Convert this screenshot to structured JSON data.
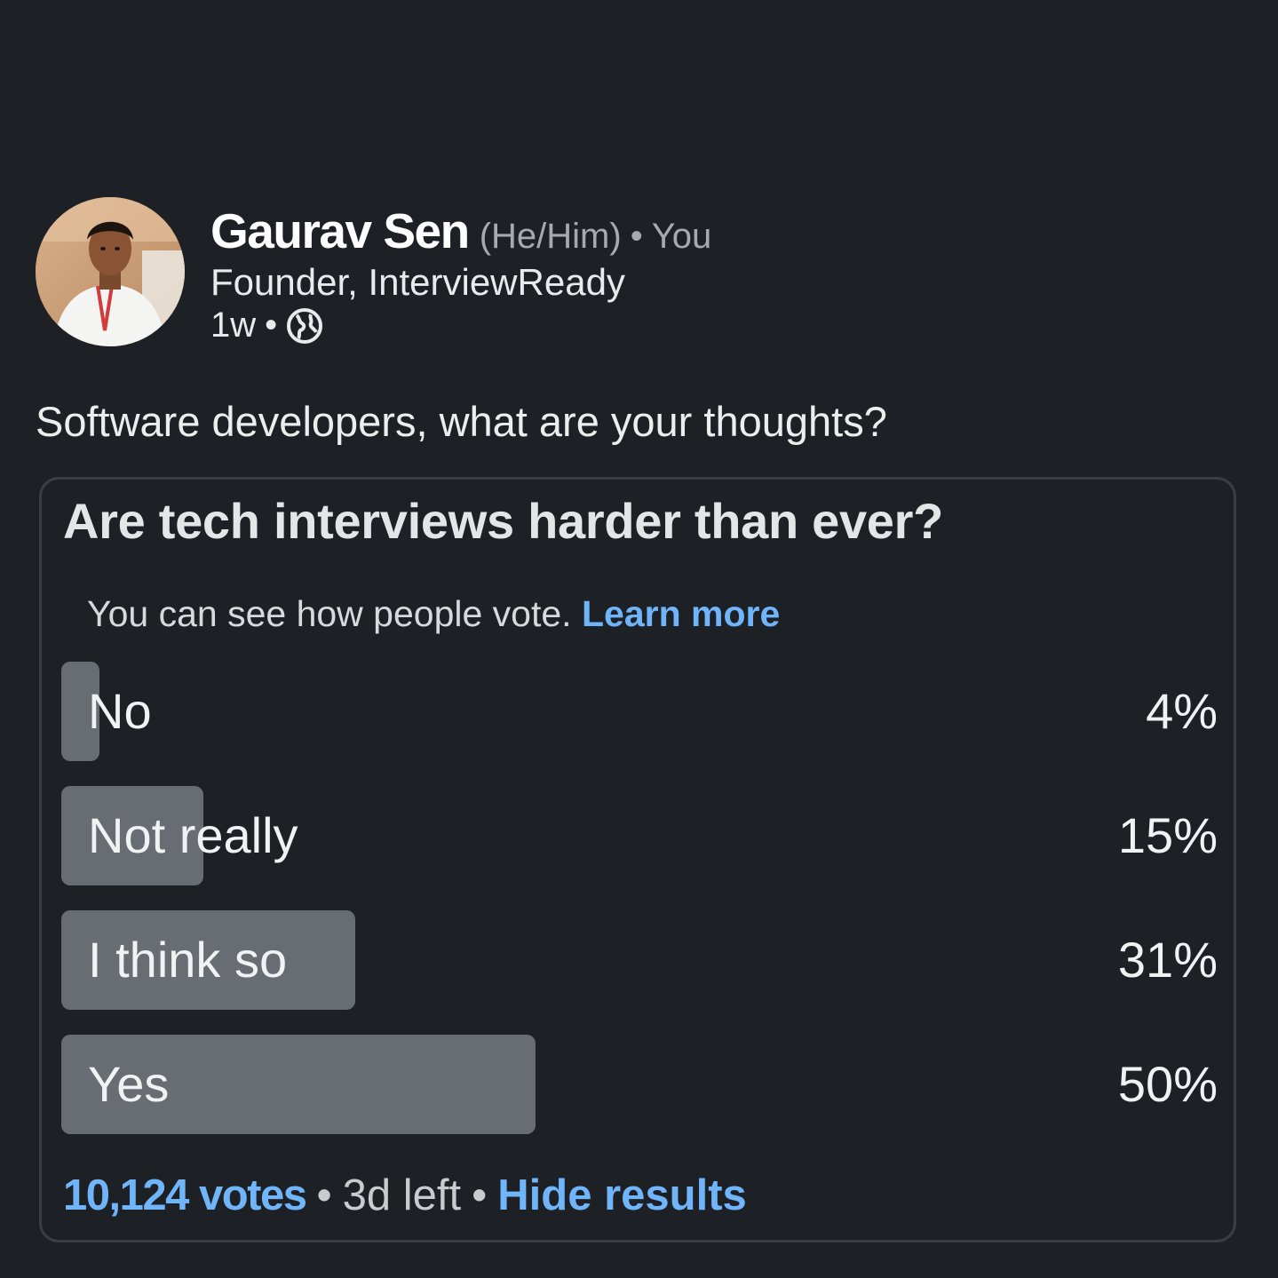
{
  "author": {
    "name": "Gaurav Sen",
    "pronouns": "(He/Him)",
    "separator": "•",
    "relation": "You",
    "headline": "Founder, InterviewReady",
    "age": "1w",
    "visibility_icon": "globe-icon"
  },
  "post": {
    "text": "Software developers, what are your thoughts?"
  },
  "poll": {
    "question": "Are tech interviews harder than ever?",
    "visibility_note": "You can see how people vote.",
    "learn_more": "Learn more",
    "options": [
      {
        "label": "No",
        "percent_text": "4%",
        "percent": 4
      },
      {
        "label": "Not really",
        "percent_text": "15%",
        "percent": 15
      },
      {
        "label": "I think so",
        "percent_text": "31%",
        "percent": 31
      },
      {
        "label": "Yes",
        "percent_text": "50%",
        "percent": 50
      }
    ],
    "votes": "10,124 votes",
    "time_left": "3d left",
    "hide_results": "Hide results"
  },
  "colors": {
    "background": "#1d2126",
    "bar": "#676d72",
    "link": "#70b5f9"
  }
}
